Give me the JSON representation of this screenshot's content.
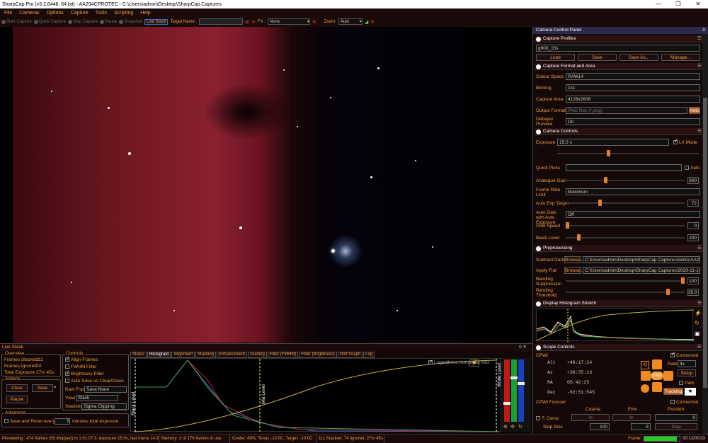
{
  "window": {
    "title": "SharpCap Pro (v3.2.6448, 64 bit) - AA294CPROTEC - C:\\Users\\admin\\Desktop\\SharpCap Captures",
    "controls": [
      "—",
      "❐",
      "✕"
    ]
  },
  "menu": [
    "File",
    "Cameras",
    "Options",
    "Capture",
    "Tools",
    "Scripting",
    "Help"
  ],
  "toolbar": {
    "start_capture": "Start Capture",
    "quick_capture": "Quick Capture",
    "stop_capture": "Stop Capture",
    "pause": "Pause",
    "snapshot": "Snapshot",
    "live_stack": "Live Stack",
    "target_label": "Target Name :",
    "target_value": "",
    "fx_label": "FX :",
    "fx_value": "None",
    "zoom_label": "Zoom:",
    "zoom_value": "Auto"
  },
  "live_stack": {
    "title": "Live Stack",
    "close": "0 ✕",
    "overview": {
      "legend": "Overview",
      "frames_stacked_label": "Frames Stacked:",
      "frames_stacked": "111",
      "frames_ignored_label": "Frames Ignored:",
      "frames_ignored": "74",
      "total_exposure_label": "Total Exposure:",
      "total_exposure": "27m 45s"
    },
    "actions": {
      "legend": "Actions",
      "clear": "Clear",
      "save": "Save",
      "pause": "Pause"
    },
    "advanced": {
      "legend": "Advanced",
      "save_reset_label": "Save and Reset every",
      "save_reset_value": "5",
      "minutes_label": "minutes total exposure"
    },
    "controls": {
      "legend": "Controls",
      "align_frames": "Align Frames",
      "fwhm_filter": "FWHM Filter",
      "brightness_filter": "Brightness Filter",
      "auto_save": "Auto Save on Clear/Close",
      "raw_frames_label": "Raw Frames",
      "raw_frames_value": "Save None",
      "view_label": "View",
      "view_value": "Stack",
      "stacking_label": "Stacking",
      "stacking_value": "Sigma Clipping"
    },
    "tabs": [
      "Status",
      "Histogram",
      "Alignment",
      "Stacking",
      "Enhancement",
      "Guiding",
      "Filter (FWHM)",
      "Filter (Brightness)",
      "Drift Graph",
      "Log"
    ],
    "histogram": {
      "log_axis_label": "Logarithmic Horizontal Axis",
      "black_level": "Black Level",
      "mid_level": "Mid Level",
      "white_level": "White Level"
    }
  },
  "status_bar": {
    "previewing": "Previewing : 474 frames (59 dropped) in 1:01:07.3, exposure 15.0s, last frame 14.9",
    "memory": "Memory: 3 of 176 frames in use.",
    "cooler": "Cooler: 49%, Temp: -10.0C, Target: -10.0C",
    "stack": "111 Stacked, 74 Ignored, 27m 45s",
    "frame_label": "Frame:",
    "frame_time": "00:12/00:03"
  },
  "ccp": {
    "title": "Camera Control Panel",
    "close": "0",
    "capture_profiles": {
      "header": "Capture Profiles",
      "profile": "g900_15s",
      "load": "Load",
      "save": "Save",
      "save_as": "Save As...",
      "manage": "Manage..."
    },
    "capture_format": {
      "header": "Capture Format and Area",
      "colour_space_label": "Colour Space",
      "colour_space": "RAW14",
      "binning_label": "Binning",
      "binning": "1x1",
      "capture_area_label": "Capture Area",
      "capture_area": "4128x2808",
      "output_format_label": "Output Format",
      "output_format": "PNG files (*.png)",
      "auto": "Auto",
      "debayer_label": "Debayer Preview",
      "debayer": "On"
    },
    "camera_controls": {
      "header": "Camera Controls",
      "exposure_label": "Exposure",
      "exposure": "15.0 s",
      "lx_mode": "LX Mode",
      "quick_picks_label": "Quick Picks",
      "auto": "Auto",
      "analogue_gain_label": "Analogue Gain",
      "analogue_gain": "900",
      "frame_rate_label": "Frame Rate Limit",
      "frame_rate": "Maximum",
      "auto_exp_label": "Auto Exp Target",
      "auto_exp": "72",
      "auto_gain_label": "Auto Gain with Auto Exposure",
      "auto_gain": "Off",
      "usb_label": "USB Speed",
      "usb": "0",
      "black_level_label": "Black Level",
      "black_level": "200"
    },
    "preprocessing": {
      "header": "Preprocessing",
      "subtract_dark_label": "Subtract Dark",
      "dark_path": "C:\\Users\\admin\\Desktop\\SharpCap Captures\\darks\\AA29...",
      "apply_flat_label": "Apply Flat",
      "flat_path": "C:\\Users\\admin\\Desktop\\SharpCap Captures\\2020-11-14...",
      "browse": "Browse...",
      "banding_supp_label": "Banding Suppression",
      "banding_supp": "100",
      "banding_thr_label": "Banding Threshold",
      "banding_thr": "35.0"
    },
    "display_histogram": {
      "header": "Display Histogram Stretch"
    },
    "scope_controls": {
      "header": "Scope Controls",
      "scope": "CPWI",
      "connected": "Connected",
      "alt_label": "Alt",
      "alt": "+48:17:24",
      "az_label": "Az",
      "az": "+38:55:13",
      "ra_label": "RA",
      "ra": "05:42:25",
      "dec_label": "Dec",
      "dec": "-02:51:54S",
      "rate_label": "Rate",
      "rate": "4x",
      "setup": "Setup",
      "park": "Park",
      "tracking": "Tracking",
      "stop": "STOP"
    },
    "focuser": {
      "name": "CPWI Focuser",
      "connected": "Connected",
      "coarse": "Coarse",
      "fine": "Fine",
      "position": "Position",
      "t_comp": "T. Comp",
      "step_size": "Step Size",
      "reverse": "Reverse",
      "in": "In",
      "out": "Out",
      "stop": "Stop",
      "setup": "Setup",
      "step_coarse": "100",
      "step_fine": "5",
      "position_value": "0"
    }
  }
}
